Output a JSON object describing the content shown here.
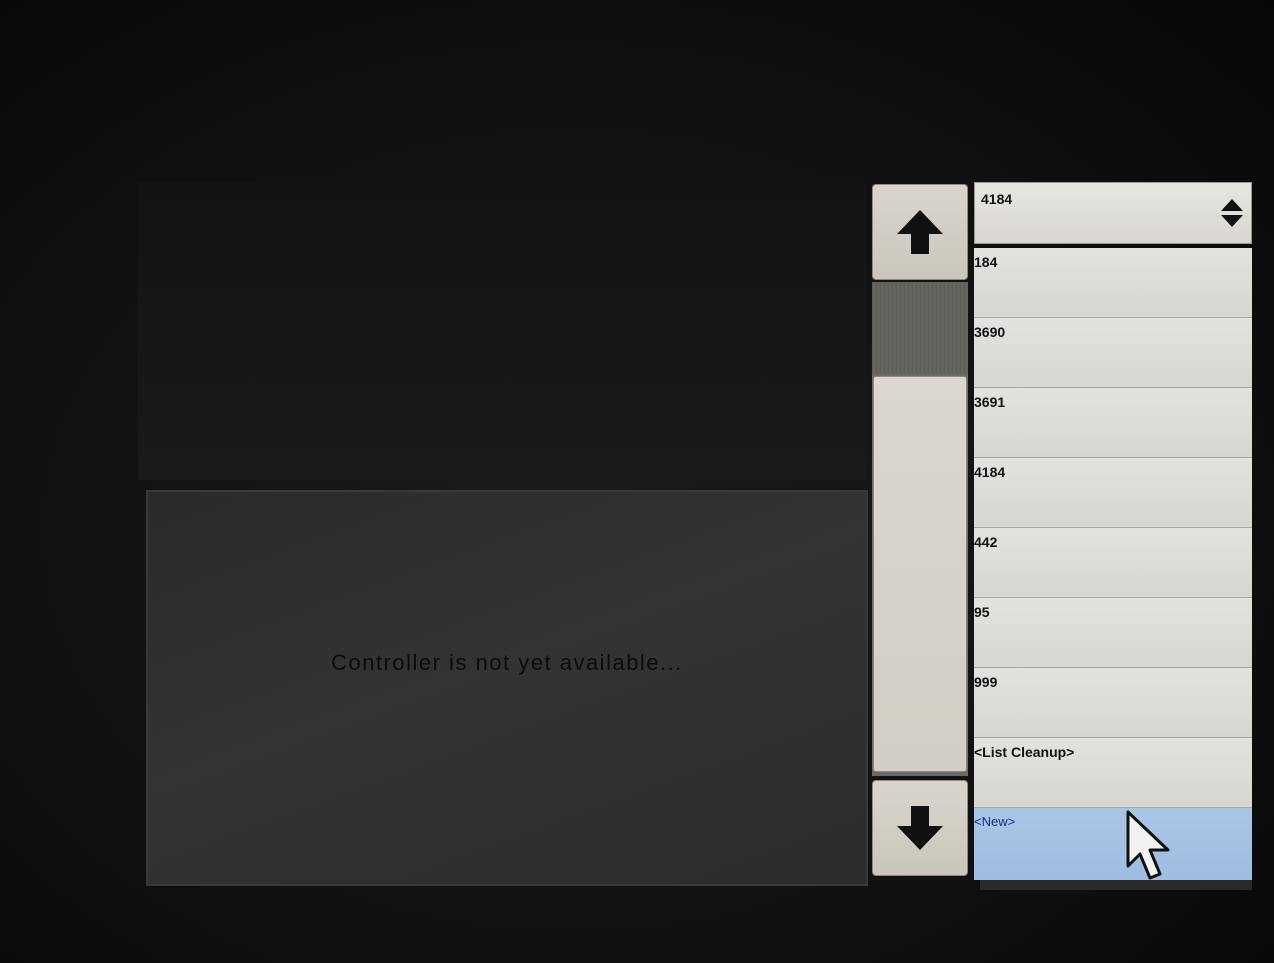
{
  "status": {
    "message": "Controller is not yet available..."
  },
  "scrollbar": {
    "up_icon": "arrow-up-icon",
    "down_icon": "arrow-down-icon"
  },
  "dropdown": {
    "selected_value": "4184",
    "arrows_icon": "up-down-arrows-icon",
    "items": [
      {
        "label": "184"
      },
      {
        "label": "3690"
      },
      {
        "label": "3691"
      },
      {
        "label": "4184"
      },
      {
        "label": "442"
      },
      {
        "label": "95"
      },
      {
        "label": "999"
      },
      {
        "label": "<List Cleanup>"
      },
      {
        "label": "<New>"
      }
    ],
    "highlighted_index": 8
  },
  "colors": {
    "highlight": "#a9c6e6",
    "highlight_text": "#1c2a8a"
  }
}
